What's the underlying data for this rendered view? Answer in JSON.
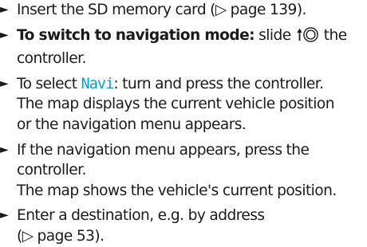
{
  "bullet_glyph": "►",
  "ref_arrow_glyph": "▷",
  "highlight_color": "#00a0d6",
  "controller_icon": "slide-up-controller-icon",
  "steps": [
    {
      "line1": "Insert the SD memory card (",
      "page_ref": "page 139",
      "line1_end": ")."
    },
    {
      "bold": "To switch to navigation mode:",
      "text_before_icon": " slide ",
      "text_after_icon": " the",
      "line2": "controller."
    },
    {
      "line1_start": "To select ",
      "display_word": "Navi",
      "line1_end": ": turn and press the controller.",
      "line2": "The map displays the current vehicle position",
      "line3": "or the navigation menu appears."
    },
    {
      "line1": "If the navigation menu appears, press the",
      "line2": "controller.",
      "line3": "The map shows the vehicle's current position."
    },
    {
      "line1": "Enter a destination, e.g. by address",
      "line2_start": "(",
      "page_ref": "page 53",
      "line2_end": ")."
    }
  ]
}
